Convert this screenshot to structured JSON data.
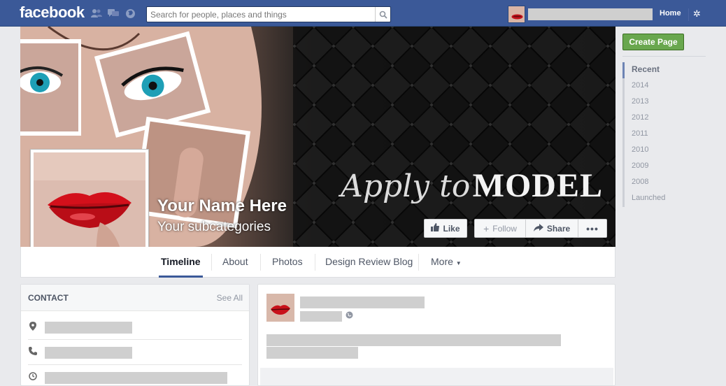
{
  "topbar": {
    "logo": "facebook",
    "search_placeholder": "Search for people, places and things",
    "home_label": "Home"
  },
  "cover": {
    "title_script": "Apply to",
    "title_bold": "MODEL"
  },
  "page": {
    "name": "Your Name Here",
    "subcategories": "Your subcategories"
  },
  "actions": {
    "like": "Like",
    "follow": "Follow",
    "share": "Share",
    "more": "•••"
  },
  "tabs": {
    "timeline": "Timeline",
    "about": "About",
    "photos": "Photos",
    "blog": "Design Review Blog",
    "more": "More"
  },
  "sidebar": {
    "create_page": "Create Page",
    "years": [
      "Recent",
      "2014",
      "2013",
      "2012",
      "2011",
      "2010",
      "2009",
      "2008",
      "Launched"
    ]
  },
  "contact": {
    "title": "CONTACT",
    "see_all": "See All"
  },
  "colors": {
    "brand": "#3b5998",
    "create_green": "#69a74e",
    "placeholder_gray": "#cfcfcf"
  }
}
